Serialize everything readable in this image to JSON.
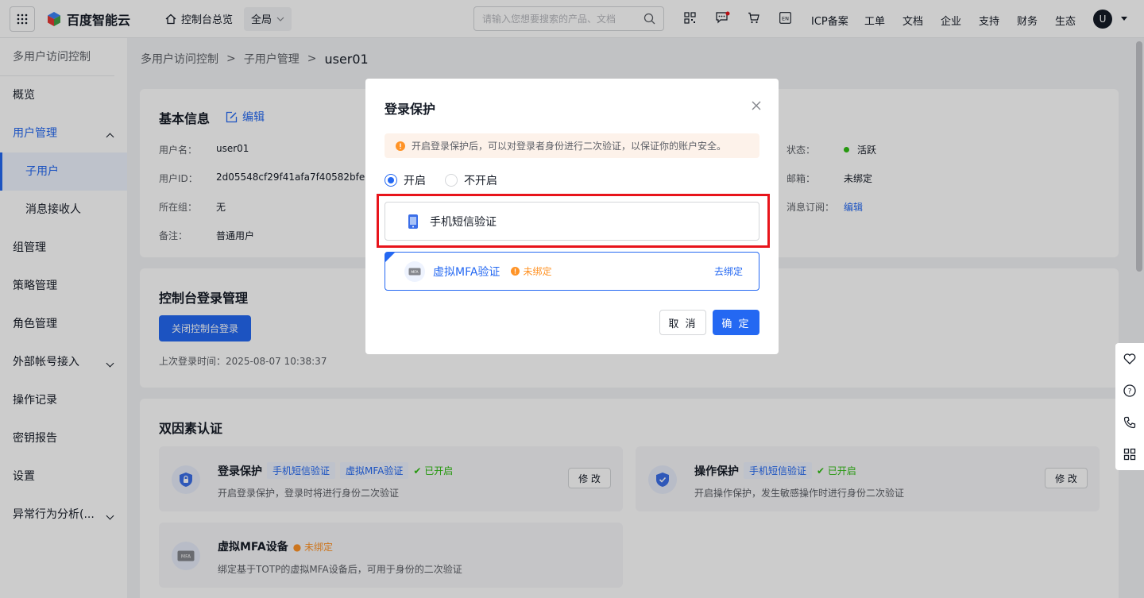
{
  "topbar": {
    "brand": "百度智能云",
    "home_label": "控制台总览",
    "scope_label": "全局",
    "search_placeholder": "请输入您想要搜索的产品、文档",
    "links": [
      "ICP备案",
      "工单",
      "文档",
      "企业",
      "支持",
      "财务",
      "生态"
    ],
    "avatar_initial": "U"
  },
  "sidebar": {
    "title": "多用户访问控制",
    "items": [
      {
        "label": "概览"
      },
      {
        "label": "用户管理"
      },
      {
        "label": "子用户"
      },
      {
        "label": "消息接收人"
      },
      {
        "label": "组管理"
      },
      {
        "label": "策略管理"
      },
      {
        "label": "角色管理"
      },
      {
        "label": "外部帐号接入"
      },
      {
        "label": "操作记录"
      },
      {
        "label": "密钥报告"
      },
      {
        "label": "设置"
      },
      {
        "label": "异常行为分析(..."
      }
    ]
  },
  "breadcrumb": {
    "root": "多用户访问控制",
    "parent": "子用户管理",
    "current": "user01"
  },
  "basic_info": {
    "title": "基本信息",
    "edit_label": "编辑",
    "username_label": "用户名：",
    "username": "user01",
    "userid_label": "用户ID：",
    "userid": "2d05548cf29f41afa7f40582bfe5",
    "group_label": "所在组：",
    "group": "无",
    "remark_label": "备注：",
    "remark": "普通用户",
    "status_label": "状态：",
    "status": "活跃",
    "email_label": "邮箱：",
    "email": "未绑定",
    "subscribe_label": "消息订阅：",
    "subscribe_link": "编辑"
  },
  "console_login": {
    "title": "控制台登录管理",
    "close_button": "关闭控制台登录",
    "last_login": "上次登录时间：2025-08-07 10:38:37"
  },
  "mfa": {
    "title": "双因素认证",
    "login_protect": {
      "name": "登录保护",
      "tags": [
        "手机短信验证",
        "虚拟MFA验证"
      ],
      "status": "已开启",
      "desc": "开启登录保护，登录时将进行身份二次验证",
      "modify": "修 改"
    },
    "op_protect": {
      "name": "操作保护",
      "tags": [
        "手机短信验证"
      ],
      "status": "已开启",
      "desc": "开启操作保护，发生敏感操作时进行身份二次验证",
      "modify": "修 改"
    },
    "virtual_device": {
      "name": "虚拟MFA设备",
      "status": "未绑定",
      "desc": "绑定基于TOTP的虚拟MFA设备后，可用于身份的二次验证"
    }
  },
  "modal": {
    "title": "登录保护",
    "tip": "开启登录保护后，可以对登录者身份进行二次验证，以保证你的账户安全。",
    "radio_on": "开启",
    "radio_off": "不开启",
    "option_sms": "手机短信验证",
    "option_mfa": "虚拟MFA验证",
    "mfa_status": "未绑定",
    "mfa_bind": "去绑定",
    "cancel": "取 消",
    "confirm": "确 定"
  },
  "colors": {
    "accent": "#2468f2",
    "success": "#30bf13",
    "warning": "#ff9326",
    "highlight": "#e8141b"
  }
}
